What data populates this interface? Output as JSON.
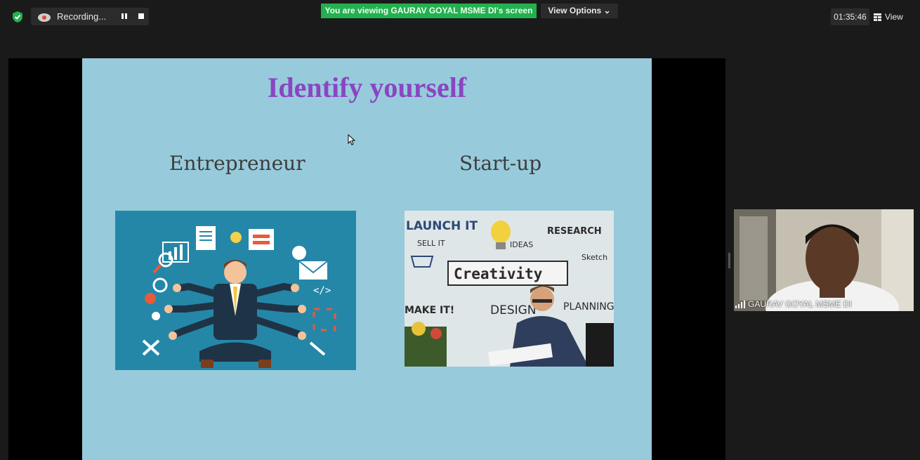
{
  "topbar": {
    "recording_label": "Recording...",
    "viewing_banner": "You are viewing GAURAV GOYAL MSME DI's screen",
    "view_options_label": "View Options",
    "timer": "01:35:46",
    "view_label": "View"
  },
  "slide": {
    "title": "Identify yourself",
    "left_label": "Entrepreneur",
    "right_label": "Start-up",
    "right_image_text": {
      "launch": "LAUNCH IT",
      "sell": "SELL IT",
      "ideas": "IDEAS",
      "research": "RESEARCH",
      "sketch": "Sketch",
      "creativity": "Creativity",
      "make": "MAKE IT!",
      "design": "DESIGN",
      "planning": "PLANNING"
    }
  },
  "participant": {
    "name": "GAURAV GOYAL MSME DI"
  },
  "colors": {
    "banner_green": "#23b04e",
    "slide_bg": "#97cbdc",
    "title_purple": "#8a45c2"
  }
}
